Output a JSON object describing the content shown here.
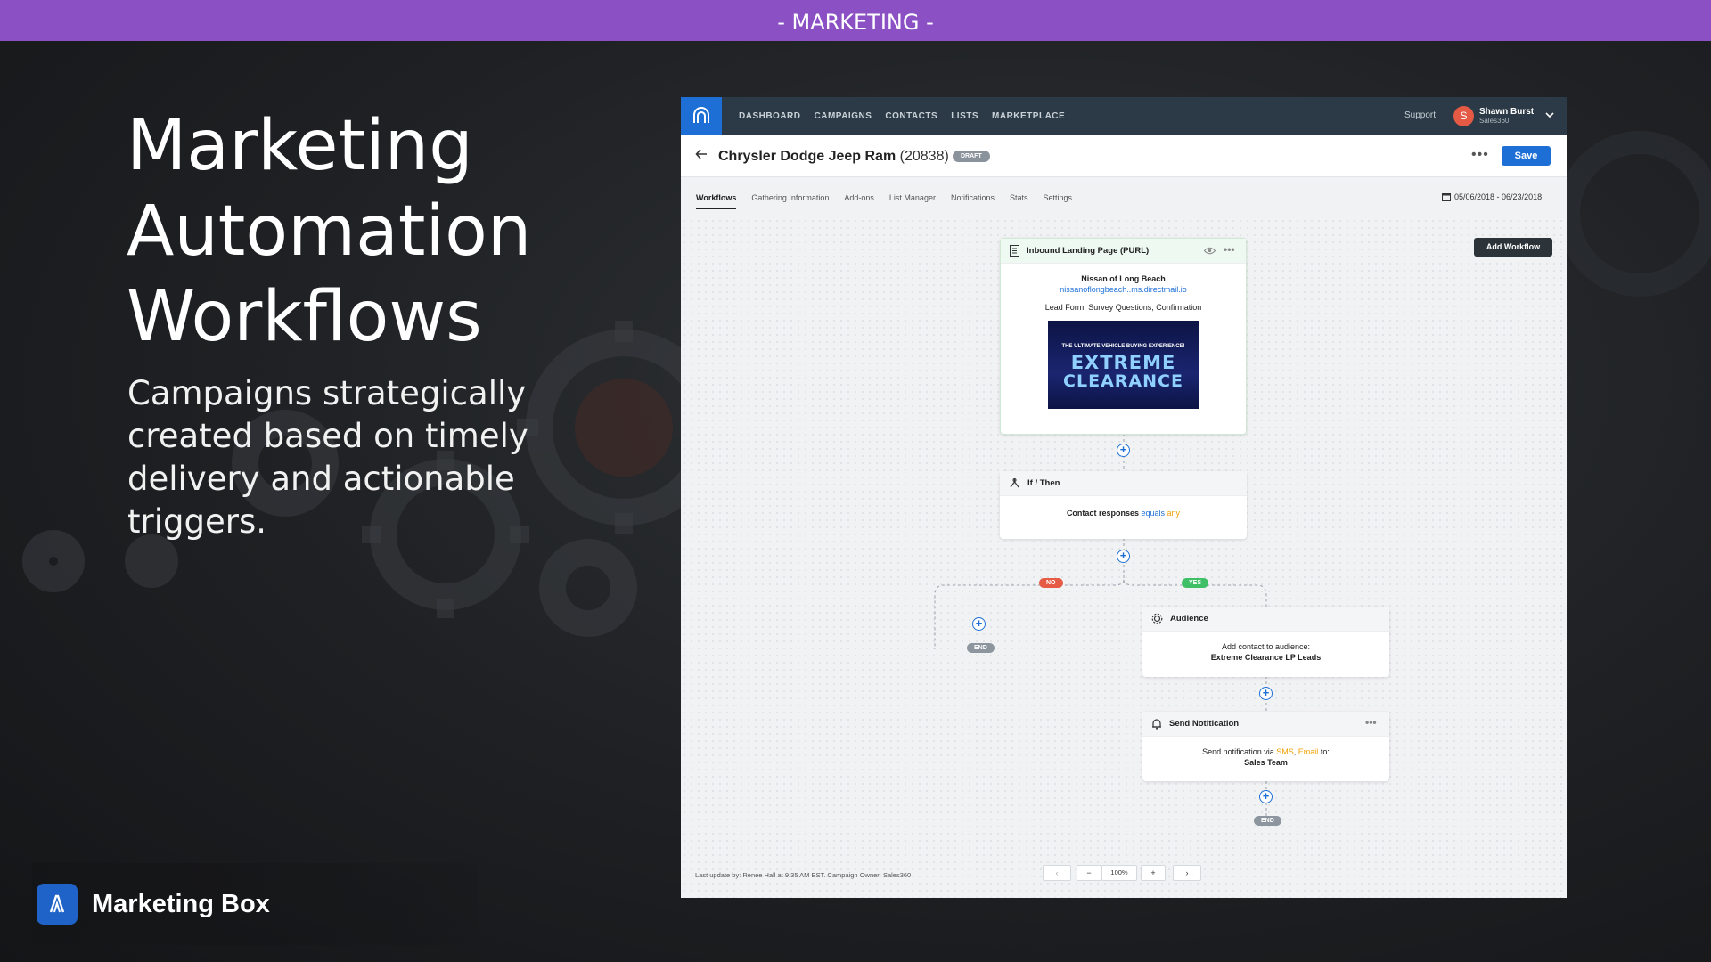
{
  "slide": {
    "header": "- MARKETING -",
    "headline_lines": [
      "Marketing",
      "Automation",
      "Workflows"
    ],
    "subcopy": "Campaigns strategically created based on timely delivery and actionable triggers.",
    "brand_name": "Marketing Box"
  },
  "app": {
    "nav": {
      "links": [
        "DASHBOARD",
        "CAMPAIGNS",
        "CONTACTS",
        "LISTS",
        "MARKETPLACE"
      ],
      "support": "Support",
      "avatar_initial": "S",
      "user_name": "Shawn Burst",
      "user_org": "Sales360"
    },
    "campaign": {
      "title": "Chrysler Dodge Jeep Ram",
      "id": "(20838)",
      "status": "DRAFT",
      "more": "•••",
      "save_label": "Save"
    },
    "tabs": [
      "Workflows",
      "Gathering Information",
      "Add-ons",
      "List Manager",
      "Notifications",
      "Stats",
      "Settings"
    ],
    "active_tab": "Workflows",
    "date_range": "05/06/2018 - 06/23/2018",
    "add_workflow_label": "Add Workflow",
    "nodes": {
      "landing": {
        "title": "Inbound Landing Page (PURL)",
        "dealer": "Nissan of Long Beach",
        "url": "nissanoflongbeach..ms.directmail.io",
        "desc": "Lead Form, Survey Questions, Confirmation",
        "banner_top": "THE ULTIMATE VEHICLE BUYING EXPERIENCE!",
        "banner_line1": "EXTREME",
        "banner_line2": "CLEARANCE"
      },
      "ifthen": {
        "title": "If / Then",
        "condition_prefix": "Contact responses",
        "condition_op": "equals",
        "condition_value": "any"
      },
      "audience": {
        "title": "Audience",
        "line1": "Add contact to audience:",
        "line2": "Extreme Clearance LP Leads"
      },
      "notification": {
        "title": "Send Notitication",
        "prefix": "Send notification via",
        "sms": "SMS",
        "sep": ",",
        "email": "Email",
        "suffix": "to:",
        "target": "Sales Team"
      }
    },
    "branch_labels": {
      "no": "NO",
      "yes": "YES",
      "end": "END"
    },
    "footer": {
      "last_update": "Last update by: Renee Hall at 9:35 AM EST. Campaign Owner: Sales360",
      "prev": "‹",
      "zoom_out": "−",
      "zoom_level": "100%",
      "zoom_in": "+",
      "next": "›"
    }
  },
  "colors": {
    "header_purple": "#8a50c4",
    "app_nav": "#2b3a46",
    "primary_blue": "#1d6fd6",
    "no_red": "#e65b45",
    "yes_green": "#3fbf66",
    "highlight_orange": "#f0a000"
  }
}
